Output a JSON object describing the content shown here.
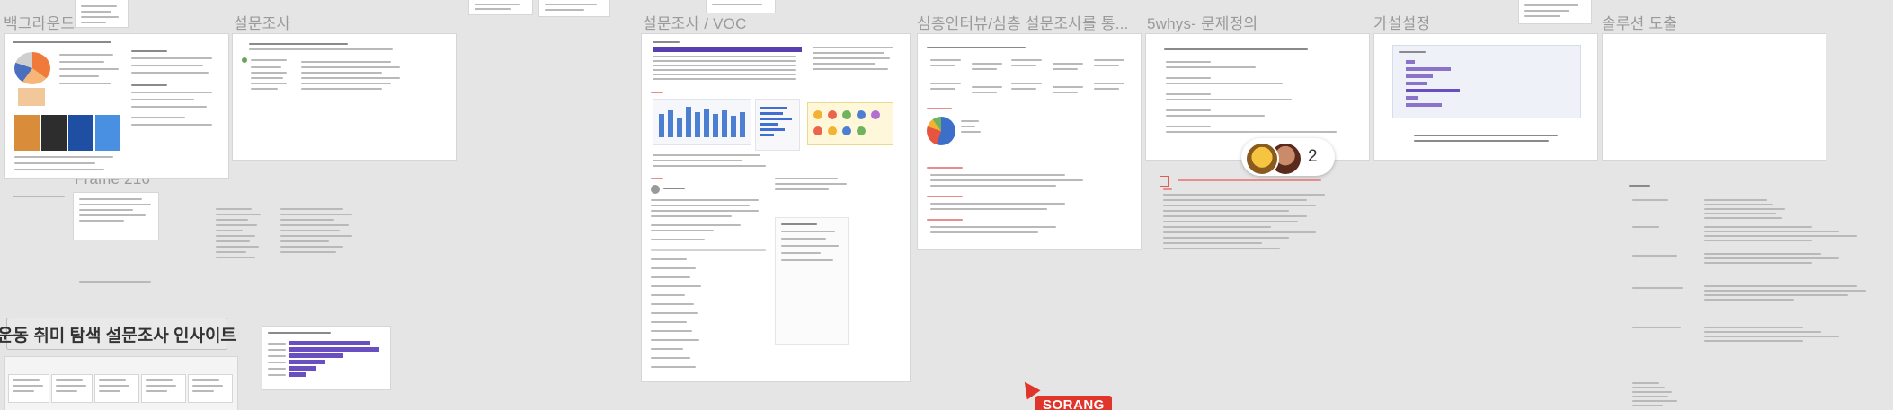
{
  "frames": {
    "background_title": "백그라운드",
    "survey_title": "설문조사",
    "voc_title": "설문조사 / VOC",
    "interview_title": "심층인터뷰/심층 설문조사를 통...",
    "fivewhys_title": "5whys- 문제정의",
    "hypothesis_title": "가설설정",
    "solution_title": "솔루션 도출",
    "frame216_title": "Frame 216"
  },
  "insight_label": "운동 취미 탐색 설문조사 인사이트",
  "collaborators": {
    "count": "2"
  },
  "cursor": {
    "user": "SORANG"
  },
  "colors": {
    "accent": "#6a4fc2",
    "cursor": "#e0352b",
    "canvas": "#e5e5e5"
  }
}
